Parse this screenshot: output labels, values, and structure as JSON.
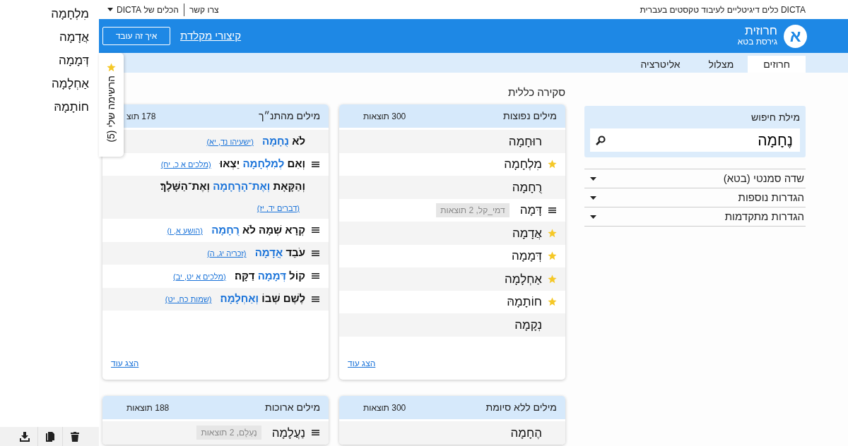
{
  "top_bar": {
    "site_title": "DICTA כלים דיגיטליים לעיבוד טקסטים בעברית",
    "links": [
      "צרו קשר",
      "הכלים של DICTA"
    ]
  },
  "header": {
    "logo_letter": "א",
    "app_name": "חרוזית",
    "subtitle": "גירסת בטא",
    "shortcuts_link": "קיצורי מקלדת",
    "help_button": "איך זה עובד"
  },
  "tabs": [
    {
      "label": "חרוזים",
      "selected": true
    },
    {
      "label": "מצלול",
      "selected": false
    },
    {
      "label": "אליטרציה",
      "selected": false
    }
  ],
  "search": {
    "label": "מילת חיפוש",
    "value": "נֶחָמָה"
  },
  "filters": [
    {
      "label": "שדה סמנטי (בטא)",
      "expanded": false
    },
    {
      "label": "הגדרות נוספות",
      "expanded": false
    },
    {
      "label": "הגדרות מתקדמות",
      "expanded": false
    }
  ],
  "overview_title": "סקירה כללית",
  "cards": [
    {
      "title": "מילים נפוצות",
      "count": "300 תוצאות",
      "kind": "words",
      "more_link": "הצג עוד",
      "rows": [
        {
          "word": "רוּחָמָה",
          "starred": false,
          "menu": false
        },
        {
          "word": "מִלְחָמָה",
          "starred": true,
          "menu": false
        },
        {
          "word": "רֻחָמָה",
          "starred": false,
          "menu": false
        },
        {
          "word": "דָּמָה",
          "starred": false,
          "menu": true,
          "tag": "דמי_קל, 2 תוצאות"
        },
        {
          "word": "אֲדָמָה",
          "starred": true,
          "menu": false
        },
        {
          "word": "דְּמָמָה",
          "starred": true,
          "menu": false
        },
        {
          "word": "אַחְלָמָה",
          "starred": true,
          "menu": false
        },
        {
          "word": "חוֹתָמָהּ",
          "starred": true,
          "menu": false
        },
        {
          "word": "נְקָמָה",
          "starred": false,
          "menu": false
        }
      ]
    },
    {
      "title": "מילים מהתנ״ך",
      "count": "178 תוצ",
      "kind": "verses",
      "more_link": "הצג עוד",
      "rows": [
        {
          "before": "לֹא",
          "match": "נֻחָמָה",
          "citation": "(ישעיהו נד, יא)",
          "menu": false
        },
        {
          "before": "וְאִם",
          "match": "לְמִלְחָמָה",
          "after": "יֵצְאוּ",
          "citation": "(מלכים א כ, יח)",
          "menu": true
        },
        {
          "before": "וְהַקָּאָת",
          "match": "וְאֶת־הָרָחָמָה",
          "after": "וְאֶת־הַשָּׁלָךְ׃",
          "citation": "(דברים יד, יז)",
          "menu": false
        },
        {
          "before": "קְרָא שְׁמָהּ לֹא",
          "match": "רֻחָמָה",
          "citation": "(הושע א, ו)",
          "menu": true
        },
        {
          "before": "עֹבֵד",
          "match": "אֲדָמָה",
          "citation": "(זכריה יג, ה)",
          "menu": true
        },
        {
          "before": "קוֹל",
          "match": "דְּמָמָה",
          "after": "דַקָּה׃",
          "citation": "(מלכים א יט, יב)",
          "menu": true
        },
        {
          "before": "לֶשֶׁם שְׁבוֹ",
          "match": "וְאַחְלָמָה׃",
          "citation": "(שמות כח, יט)",
          "menu": true
        }
      ]
    },
    {
      "title": "מילים ללא סיומת",
      "count": "300 תוצאות",
      "kind": "words",
      "rows": [
        {
          "word": "הֶחָמָה",
          "starred": false,
          "menu": false
        }
      ]
    },
    {
      "title": "מילים ארוכות",
      "count": "188 תוצאות",
      "kind": "words",
      "rows": [
        {
          "word": "נַעֲלָמָה",
          "starred": false,
          "menu": true,
          "tag": "נֶעְלָם, 2 תוצאות"
        }
      ]
    }
  ],
  "my_list": {
    "tab_label": "הרשימה שלי (5)",
    "items": [
      "מִלְחָמָה",
      "אֲדָמָה",
      "דְּמָמָה",
      "אַחְלָמָה",
      "חוֹתָמָהּ"
    ]
  }
}
